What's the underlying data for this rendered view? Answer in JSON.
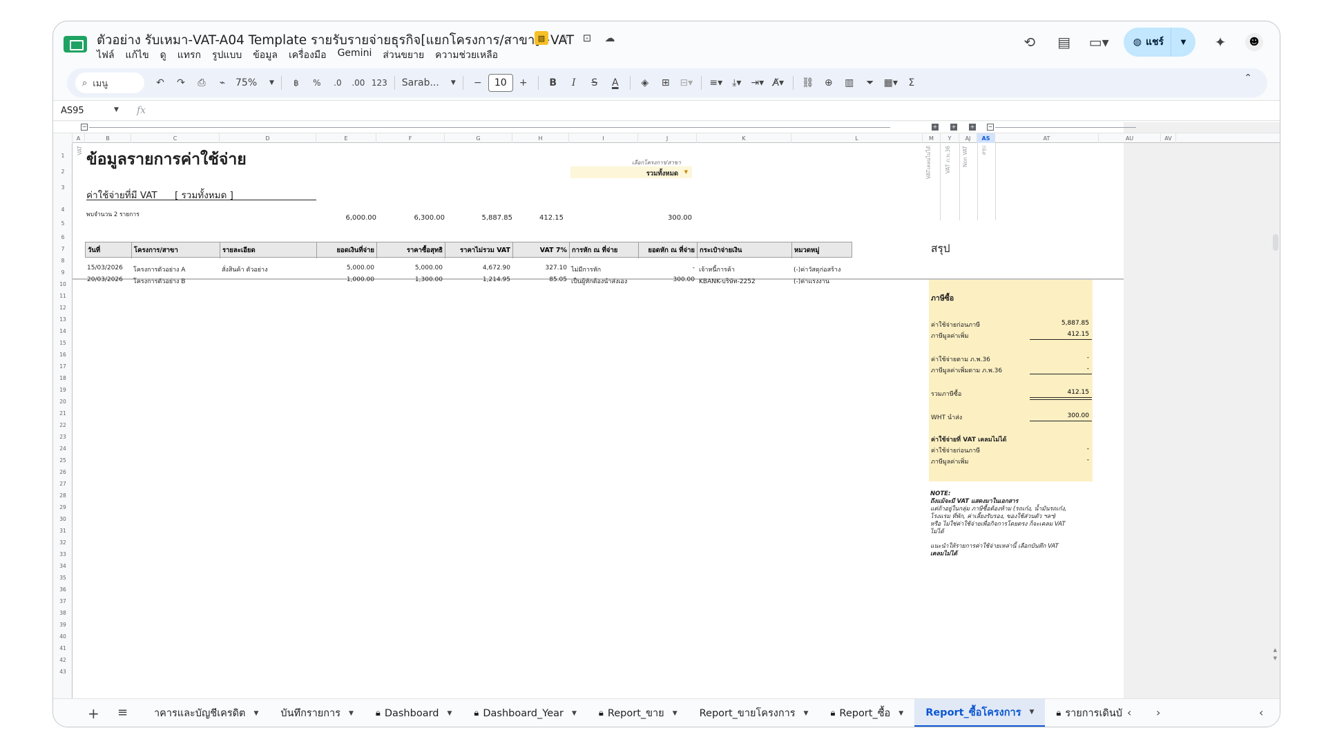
{
  "window": {
    "title": "ตัวอย่าง รับเหมา-VAT-A04 Template รายรับรายจ่ายธุรกิจ[แยกโครงการ/สาขา]+VAT",
    "menus": [
      "ไฟล์",
      "แก้ไข",
      "ดู",
      "แทรก",
      "รูปแบบ",
      "ข้อมูล",
      "เครื่องมือ",
      "Gemini",
      "ส่วนขยาย",
      "ความช่วยเหลือ"
    ],
    "share_label": "แชร์"
  },
  "toolbar": {
    "search_label": "เมนู",
    "zoom": "75%",
    "currency": "฿",
    "percent": "%",
    "dec_decrease": ".0",
    "dec_increase": ".00",
    "format_123": "123",
    "font": "Sarab...",
    "font_size": "10",
    "bold": "B",
    "italic": "I",
    "strike": "S",
    "text_color": "A",
    "sum": "Σ"
  },
  "formula_bar": {
    "cell_ref": "AS95",
    "fx": "fx"
  },
  "columns": [
    "A",
    "B",
    "C",
    "D",
    "E",
    "F",
    "G",
    "H",
    "I",
    "J",
    "K",
    "L",
    "M",
    "Y",
    "AJ",
    "AS",
    "AT",
    "AU",
    "AV"
  ],
  "rows": [
    "1",
    "2",
    "3",
    "4",
    "5",
    "6",
    "7",
    "8",
    "9",
    "10",
    "11",
    "12",
    "13",
    "14",
    "15",
    "16",
    "17",
    "18",
    "19",
    "20",
    "21",
    "22",
    "23",
    "24",
    "25",
    "26",
    "27",
    "28",
    "29",
    "30",
    "31",
    "32",
    "33",
    "34",
    "35",
    "36",
    "37",
    "38",
    "39",
    "40",
    "41",
    "42",
    "43"
  ],
  "sheet": {
    "title": "ข้อมูลรายการค่าใช้จ่าย",
    "select_label": "เลือกโครงการ/สาขา",
    "select_value": "รวมทั้งหมด",
    "subtitle": "ค่าใช้จ่ายที่มี VAT",
    "subtitle_scope": "[ รวมทั้งหมด ]",
    "found_count": "พบจำนวน 2 รายการ",
    "vat_col_label": "VAT",
    "rotated_labels": [
      "VATเคลมไม่ได้",
      "VAT ภ.พ.36",
      "Non VAT",
      "สรุป"
    ],
    "totals": {
      "amount": "6,000.00",
      "net": "6,300.00",
      "pre_vat": "5,887.85",
      "vat": "412.15",
      "wht": "300.00"
    },
    "headers": [
      "วันที่",
      "โครงการ/สาขา",
      "รายละเอียด",
      "ยอดเงินที่จ่าย",
      "ราคาซื้อสุทธิ",
      "ราคาไม่รวม VAT",
      "VAT 7%",
      "การหัก ณ ที่จ่าย",
      "ยอดหัก ณ ที่จ่าย",
      "กระเป๋าจ่ายเงิน",
      "หมวดหมู่"
    ],
    "data_rows": [
      [
        "15/03/2026",
        "โครงการตัวอย่าง A",
        "สั่งสินค้า ตัวอย่าง",
        "5,000.00",
        "5,000.00",
        "4,672.90",
        "327.10",
        "ไม่มีการหัก",
        "-",
        "เจ้าหนี้การค้า",
        "(-)ค่าวัสดุก่อสร้าง"
      ],
      [
        "20/03/2026",
        "โครงการตัวอย่าง B",
        "",
        "1,000.00",
        "1,300.00",
        "1,214.95",
        "85.05",
        "เป็นผู้หักต้องนำส่งเอง",
        "300.00",
        "KBANK-บริษัท-2252",
        "(-)ค่าแรงงาน"
      ]
    ]
  },
  "summary": {
    "title": "สรุป",
    "section_tax": "ภาษีซื้อ",
    "pre_tax_label": "ค่าใช้จ่ายก่อนภาษี",
    "pre_tax_value": "5,887.85",
    "vat_label": "ภาษีมูลค่าเพิ่ม",
    "vat_value": "412.15",
    "pp36_label": "ค่าใช้จ่ายตาม ภ.พ.36",
    "pp36_value": "-",
    "pp36_vat_label": "ภาษีมูลค่าเพิ่มตาม ภ.พ.36",
    "pp36_vat_value": "-",
    "total_tax_label": "รวมภาษีซื้อ",
    "total_tax_value": "412.15",
    "wht_label": "WHT นำส่ง",
    "wht_value": "300.00",
    "section_nonclaim": "ค่าใช้จ่ายที่ VAT เคลมไม่ได้",
    "nc_pre_tax_label": "ค่าใช้จ่ายก่อนภาษี",
    "nc_pre_tax_value": "-",
    "nc_vat_label": "ภาษีมูลค่าเพิ่ม",
    "nc_vat_value": "-"
  },
  "note": {
    "heading": "NOTE:",
    "line1": "ถึงแม้จะมี VAT แสดงมาในเอกสาร",
    "line2": "แต่ถ้าอยู่ในกลุ่ม ภาษีซื้อต้องห้าม (รถเก๋ง, น้ำมันรถเก๋ง,",
    "line3": "โรงแรม ที่พัก, ค่าเลี้ยงรับรอง, ของใช้ส่วนตัว ฯลฯ)",
    "line4": "หรือ ไม่ใช่ค่าใช้จ่ายเพื่อกิจการโดยตรง ก็จะเคลม VAT",
    "line5": "ไม่ได้",
    "line6": "แนะนำให้รายการค่าใช้จ่ายเหล่านี้ เลือกบันทึก VAT",
    "line7": "เคลมไม่ได้"
  },
  "tabs": [
    {
      "label": "าคารและบัญชีเครดิต",
      "locked": false,
      "active": false
    },
    {
      "label": "บันทึกรายการ",
      "locked": false,
      "active": false
    },
    {
      "label": "Dashboard",
      "locked": true,
      "active": false
    },
    {
      "label": "Dashboard_Year",
      "locked": true,
      "active": false
    },
    {
      "label": "Report_ขาย",
      "locked": true,
      "active": false
    },
    {
      "label": "Report_ขายโครงการ",
      "locked": false,
      "active": false
    },
    {
      "label": "Report_ซื้อ",
      "locked": true,
      "active": false
    },
    {
      "label": "Report_ซื้อโครงการ",
      "locked": false,
      "active": true
    },
    {
      "label": "รายการเดินบั",
      "locked": true,
      "active": false
    }
  ]
}
